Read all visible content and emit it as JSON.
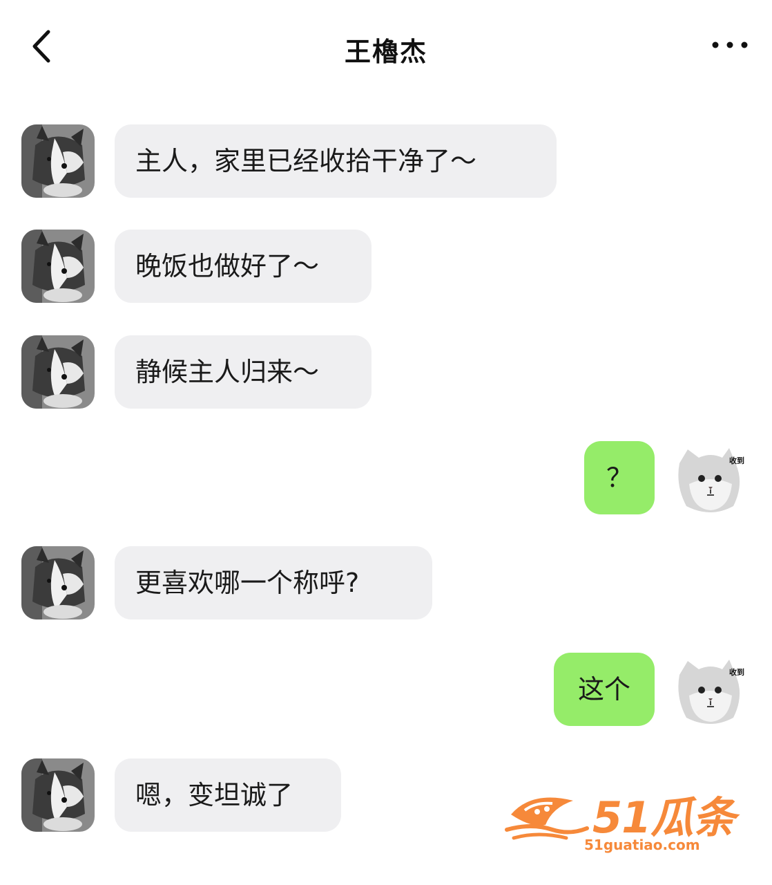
{
  "header": {
    "title": "王櫓杰",
    "back_icon": "chevron-left-icon",
    "more_icon": "more-dots-icon"
  },
  "messages": [
    {
      "direction": "incoming",
      "text": "主人，家里已经收拾干净了～"
    },
    {
      "direction": "incoming",
      "text": "晚饭也做好了～"
    },
    {
      "direction": "incoming",
      "text": "静候主人归来～"
    },
    {
      "direction": "outgoing",
      "text": "？"
    },
    {
      "direction": "incoming",
      "text": "更喜欢哪一个称呼?"
    },
    {
      "direction": "outgoing",
      "text": "这个"
    },
    {
      "direction": "incoming",
      "text": "嗯，变坦诚了"
    }
  ],
  "avatars": {
    "other": "dog-avatar",
    "self": "cat-avatar",
    "self_caption": "收到"
  },
  "watermark": {
    "brand": "51瓜条",
    "url": "51guatiao.com"
  },
  "colors": {
    "incoming_bubble": "#efeff1",
    "outgoing_bubble": "#95ec69",
    "watermark": "#f6893a"
  }
}
